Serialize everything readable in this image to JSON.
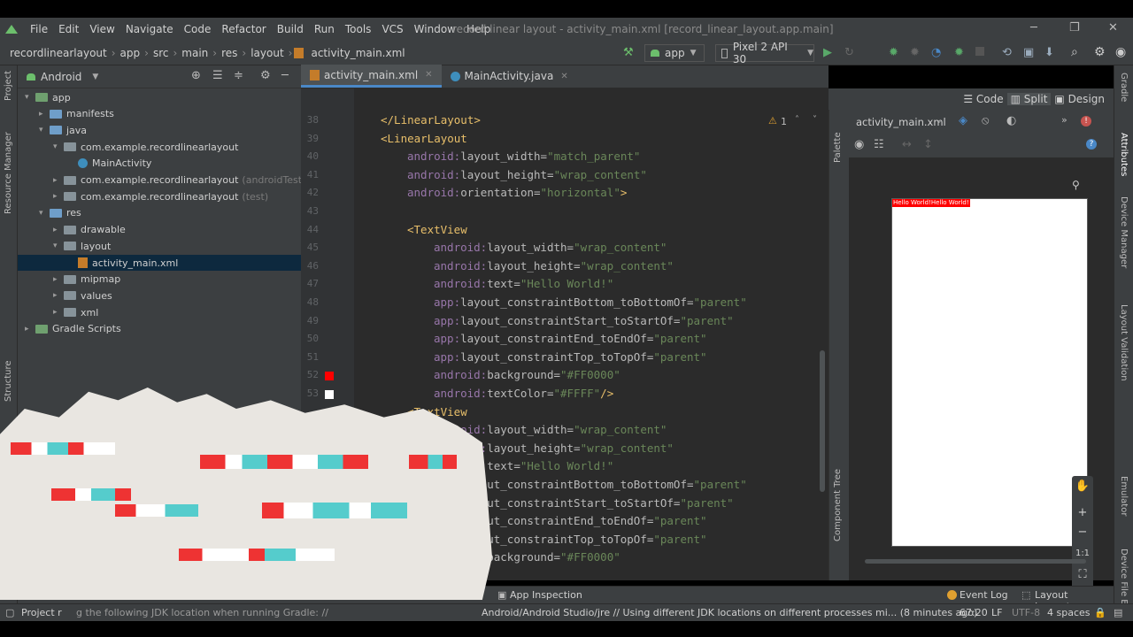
{
  "menubar": {
    "items": [
      "File",
      "Edit",
      "View",
      "Navigate",
      "Code",
      "Refactor",
      "Build",
      "Run",
      "Tools",
      "VCS",
      "Window",
      "Help"
    ],
    "window_title": "record linear layout - activity_main.xml [record_linear_layout.app.main]"
  },
  "navbar": {
    "breadcrumbs": [
      "recordlinearlayout",
      "app",
      "src",
      "main",
      "res",
      "layout",
      "activity_main.xml"
    ],
    "run_config": "app",
    "device": "Pixel 2 API 30"
  },
  "project": {
    "view_label": "Android",
    "tree": [
      {
        "label": "app",
        "indent": 0,
        "arrow": "▾",
        "icon": "folder-green"
      },
      {
        "label": "manifests",
        "indent": 1,
        "arrow": "▸",
        "icon": "folder-blue"
      },
      {
        "label": "java",
        "indent": 1,
        "arrow": "▾",
        "icon": "folder-blue"
      },
      {
        "label": "com.example.recordlinearlayout",
        "indent": 2,
        "arrow": "▾",
        "icon": "folder"
      },
      {
        "label": "MainActivity",
        "indent": 3,
        "arrow": "",
        "icon": "java-class"
      },
      {
        "label": "com.example.recordlinearlayout",
        "suffix": "(androidTest)",
        "indent": 2,
        "arrow": "▸",
        "icon": "folder"
      },
      {
        "label": "com.example.recordlinearlayout",
        "suffix": "(test)",
        "indent": 2,
        "arrow": "▸",
        "icon": "folder"
      },
      {
        "label": "res",
        "indent": 1,
        "arrow": "▾",
        "icon": "folder-blue"
      },
      {
        "label": "drawable",
        "indent": 2,
        "arrow": "▸",
        "icon": "folder"
      },
      {
        "label": "layout",
        "indent": 2,
        "arrow": "▾",
        "icon": "folder"
      },
      {
        "label": "activity_main.xml",
        "indent": 3,
        "arrow": "",
        "icon": "xml-file",
        "selected": true
      },
      {
        "label": "mipmap",
        "indent": 2,
        "arrow": "▸",
        "icon": "folder"
      },
      {
        "label": "values",
        "indent": 2,
        "arrow": "▸",
        "icon": "folder"
      },
      {
        "label": "xml",
        "indent": 2,
        "arrow": "▸",
        "icon": "folder"
      },
      {
        "label": "Gradle Scripts",
        "indent": 0,
        "arrow": "▸",
        "icon": "gradle"
      }
    ]
  },
  "tabs": [
    {
      "label": "activity_main.xml",
      "active": true
    },
    {
      "label": "MainActivity.java",
      "active": false
    }
  ],
  "editor": {
    "warning_count": "1",
    "lines": [
      {
        "n": "38",
        "indent": 0,
        "parts": [
          [
            "tag",
            "</LinearLayout>"
          ]
        ]
      },
      {
        "n": "39",
        "indent": 0,
        "parts": [
          [
            "tag",
            "<LinearLayout"
          ]
        ]
      },
      {
        "n": "40",
        "indent": 1,
        "parts": [
          [
            "ns",
            "android:"
          ],
          [
            "attr",
            "layout_width="
          ],
          [
            "val",
            "\"match_parent\""
          ]
        ]
      },
      {
        "n": "41",
        "indent": 1,
        "parts": [
          [
            "ns",
            "android:"
          ],
          [
            "attr",
            "layout_height="
          ],
          [
            "val",
            "\"wrap_content\""
          ]
        ]
      },
      {
        "n": "42",
        "indent": 1,
        "parts": [
          [
            "ns",
            "android:"
          ],
          [
            "attr",
            "orientation="
          ],
          [
            "val",
            "\"horizontal\""
          ],
          [
            "tag",
            ">"
          ]
        ]
      },
      {
        "n": "43",
        "indent": 0,
        "parts": []
      },
      {
        "n": "44",
        "indent": 1,
        "parts": [
          [
            "tag",
            "<TextView"
          ]
        ]
      },
      {
        "n": "45",
        "indent": 2,
        "parts": [
          [
            "ns",
            "android:"
          ],
          [
            "attr",
            "layout_width="
          ],
          [
            "val",
            "\"wrap_content\""
          ]
        ]
      },
      {
        "n": "46",
        "indent": 2,
        "parts": [
          [
            "ns",
            "android:"
          ],
          [
            "attr",
            "layout_height="
          ],
          [
            "val",
            "\"wrap_content\""
          ]
        ]
      },
      {
        "n": "47",
        "indent": 2,
        "parts": [
          [
            "ns",
            "android:"
          ],
          [
            "attr",
            "text="
          ],
          [
            "val",
            "\"Hello World!\""
          ]
        ]
      },
      {
        "n": "48",
        "indent": 2,
        "parts": [
          [
            "ns",
            "app:"
          ],
          [
            "attr",
            "layout_constraintBottom_toBottomOf="
          ],
          [
            "val",
            "\"parent\""
          ]
        ]
      },
      {
        "n": "49",
        "indent": 2,
        "parts": [
          [
            "ns",
            "app:"
          ],
          [
            "attr",
            "layout_constraintStart_toStartOf="
          ],
          [
            "val",
            "\"parent\""
          ]
        ]
      },
      {
        "n": "50",
        "indent": 2,
        "parts": [
          [
            "ns",
            "app:"
          ],
          [
            "attr",
            "layout_constraintEnd_toEndOf="
          ],
          [
            "val",
            "\"parent\""
          ]
        ]
      },
      {
        "n": "51",
        "indent": 2,
        "parts": [
          [
            "ns",
            "app:"
          ],
          [
            "attr",
            "layout_constraintTop_toTopOf="
          ],
          [
            "val",
            "\"parent\""
          ]
        ]
      },
      {
        "n": "52",
        "indent": 2,
        "parts": [
          [
            "ns",
            "android:"
          ],
          [
            "attr",
            "background="
          ],
          [
            "val",
            "\"#FF0000\""
          ]
        ]
      },
      {
        "n": "53",
        "indent": 2,
        "parts": [
          [
            "ns",
            "android:"
          ],
          [
            "attr",
            "textColor="
          ],
          [
            "val",
            "\"#FFFF\""
          ],
          [
            "tag",
            "/>"
          ]
        ]
      },
      {
        "n": "",
        "indent": 1,
        "parts": [
          [
            "tag",
            "<TextView"
          ]
        ]
      },
      {
        "n": "",
        "indent": 2,
        "parts": [
          [
            "ns",
            "android:"
          ],
          [
            "attr",
            "layout_width="
          ],
          [
            "val",
            "\"wrap_content\""
          ]
        ]
      },
      {
        "n": "",
        "indent": 2,
        "parts": [
          [
            "ns",
            "android:"
          ],
          [
            "attr",
            "layout_height="
          ],
          [
            "val",
            "\"wrap_content\""
          ]
        ]
      },
      {
        "n": "",
        "indent": 2,
        "parts": [
          [
            "ns",
            "android:"
          ],
          [
            "attr",
            "text="
          ],
          [
            "val",
            "\"Hello World!\""
          ]
        ]
      },
      {
        "n": "",
        "indent": 2,
        "parts": [
          [
            "ns",
            "app:"
          ],
          [
            "attr",
            "layout_constraintBottom_toBottomOf="
          ],
          [
            "val",
            "\"parent\""
          ]
        ]
      },
      {
        "n": "",
        "indent": 2,
        "parts": [
          [
            "ns",
            "app:"
          ],
          [
            "attr",
            "layout_constraintStart_toStartOf="
          ],
          [
            "val",
            "\"parent\""
          ]
        ]
      },
      {
        "n": "",
        "indent": 2,
        "parts": [
          [
            "ns",
            "app:"
          ],
          [
            "attr",
            "layout_constraintEnd_toEndOf="
          ],
          [
            "val",
            "\"parent\""
          ]
        ]
      },
      {
        "n": "",
        "indent": 2,
        "parts": [
          [
            "ns",
            "app:"
          ],
          [
            "attr",
            "layout_constraintTop_toTopOf="
          ],
          [
            "val",
            "\"parent\""
          ]
        ]
      },
      {
        "n": "",
        "indent": 2,
        "parts": [
          [
            "ns",
            "android:"
          ],
          [
            "attr",
            "background="
          ],
          [
            "val",
            "\"#FF0000\""
          ]
        ]
      }
    ]
  },
  "design": {
    "mode_code": "Code",
    "mode_split": "Split",
    "mode_design": "Design",
    "file_selector": "activity_main.xml",
    "preview_text": "Hello World!Hello World!",
    "zoom_reset": "1:1"
  },
  "side_tabs": {
    "left": [
      "Project",
      "Resource Manager",
      "Structure"
    ],
    "right": [
      "Gradle",
      "Attributes",
      "Device Manager",
      "Layout Validation",
      "Emulator",
      "Device File Explorer"
    ],
    "palette": "Palette",
    "component_tree": "Component Tree"
  },
  "bottom_tools": {
    "app_inspection": "App Inspection",
    "event_log": "Event Log",
    "layout_inspector": "Layout Inspector"
  },
  "status": {
    "message_left": "Project r",
    "message_mid": "g the following JDK location when running Gradle: //",
    "message_right": "Android/Android Studio/jre // Using different JDK locations on different processes mi... (8 minutes ago)",
    "position": "67:20",
    "line_sep": "LF",
    "encoding": "UTF-8",
    "indent": "4 spaces"
  },
  "colors": {
    "ide_bg": "#2b2b2b",
    "panel_bg": "#3c3f41",
    "accent": "#4a88c7",
    "preview_bg": "#FF0000"
  }
}
